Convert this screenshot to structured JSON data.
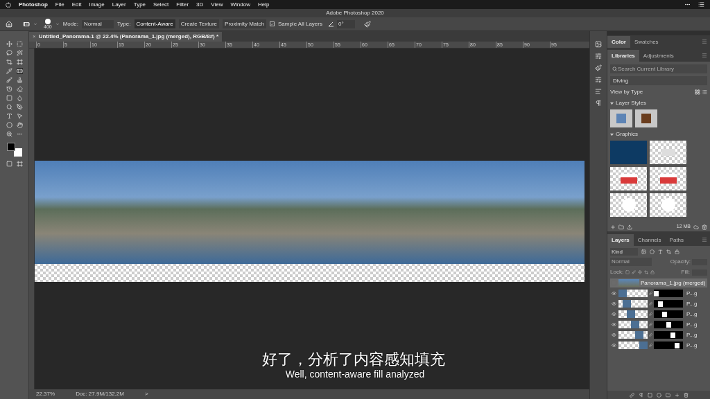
{
  "menu_bar": {
    "items": [
      "Photoshop",
      "File",
      "Edit",
      "Image",
      "Layer",
      "Type",
      "Select",
      "Filter",
      "3D",
      "View",
      "Window",
      "Help"
    ]
  },
  "window": {
    "title": "Adobe Photoshop 2020"
  },
  "options_bar": {
    "brush_size": "400",
    "mode_label": "Mode:",
    "mode": "Normal",
    "type_label": "Type:",
    "type_options": [
      {
        "label": "Content-Aware",
        "selected": true
      },
      {
        "label": "Create Texture",
        "selected": false
      },
      {
        "label": "Proximity Match",
        "selected": false
      }
    ],
    "sample_all_layers": {
      "label": "Sample All Layers",
      "checked": true
    },
    "angle": "0°"
  },
  "document_tab": {
    "close": "×",
    "title": "Untitled_Panorama-1 @ 22.4% (Panorama_1.jpg (merged), RGB/8#) *"
  },
  "ruler": {
    "ticks": [
      "0",
      "5",
      "10",
      "15",
      "20",
      "25",
      "30",
      "35",
      "40",
      "45",
      "50",
      "55",
      "60",
      "65",
      "70",
      "75",
      "80",
      "85",
      "90",
      "95"
    ]
  },
  "color_panel": {
    "tabs": [
      {
        "label": "Color",
        "selected": true
      },
      {
        "label": "Swatches",
        "selected": false
      }
    ]
  },
  "libraries_panel": {
    "tabs": [
      {
        "label": "Libraries",
        "selected": true
      },
      {
        "label": "Adjustments",
        "selected": false
      }
    ],
    "search": {
      "placeholder": "Search Current Library"
    },
    "library": "Diving",
    "view": "View by Type",
    "sections": [
      {
        "title": "Layer Styles",
        "expanded": true
      },
      {
        "title": "Graphics",
        "expanded": true
      }
    ],
    "size": "12 MB"
  },
  "layers_panel": {
    "tabs": [
      {
        "label": "Layers",
        "selected": true
      },
      {
        "label": "Channels",
        "selected": false
      },
      {
        "label": "Paths",
        "selected": false
      }
    ],
    "filter": "Kind",
    "blend_mode": "Normal",
    "opacity_label": "Opacity:",
    "lock_label": "Lock:",
    "fill_label": "Fill:",
    "layers": [
      {
        "name": "Panorama_1.jpg (merged)",
        "visible": false,
        "selected": true,
        "kind": "merged"
      },
      {
        "name": "P...g",
        "visible": true,
        "selected": false,
        "kind": "masked"
      },
      {
        "name": "P...g",
        "visible": true,
        "selected": false,
        "kind": "masked"
      },
      {
        "name": "P...g",
        "visible": true,
        "selected": false,
        "kind": "masked"
      },
      {
        "name": "P...g",
        "visible": true,
        "selected": false,
        "kind": "masked"
      },
      {
        "name": "P...g",
        "visible": true,
        "selected": false,
        "kind": "masked"
      },
      {
        "name": "P...g",
        "visible": true,
        "selected": false,
        "kind": "masked"
      }
    ]
  },
  "status_bar": {
    "zoom": "22.37%",
    "doc": "Doc: 27.9M/132.2M",
    "arrow": ">"
  },
  "subtitles": {
    "zh": "好了，分析了内容感知填充",
    "en": "Well, content-aware fill analyzed"
  }
}
